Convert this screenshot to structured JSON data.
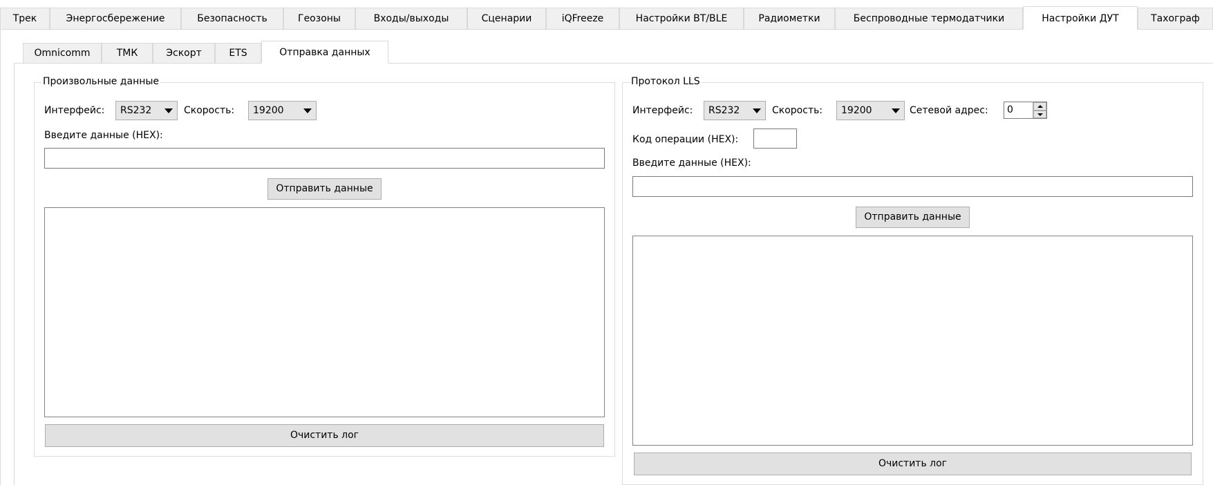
{
  "top_tabs": [
    "Трек",
    "Энергосбережение",
    "Безопасность",
    "Геозоны",
    "Входы/выходы",
    "Сценарии",
    "iQFreeze",
    "Настройки BT/BLE",
    "Радиометки",
    "Беспроводные термодатчики",
    "Настройки ДУТ",
    "Тахограф"
  ],
  "top_tabs_active": "Настройки ДУТ",
  "sub_tabs": [
    "Omnicomm",
    "ТМК",
    "Эскорт",
    "ETS",
    "Отправка данных"
  ],
  "sub_tabs_active": "Отправка данных",
  "left": {
    "title": "Произвольные данные",
    "interface_label": "Интерфейс:",
    "interface_value": "RS232",
    "speed_label": "Скорость:",
    "speed_value": "19200",
    "data_label": "Введите данные (HEX):",
    "data_value": "",
    "send_button": "Отправить данные",
    "log_text": "",
    "clear_button": "Очистить лог"
  },
  "right": {
    "title": "Протокол LLS",
    "interface_label": "Интерфейс:",
    "interface_value": "RS232",
    "speed_label": "Скорость:",
    "speed_value": "19200",
    "address_label": "Сетевой адрес:",
    "address_value": "0",
    "opcode_label": "Код операции (HEX):",
    "opcode_value": "",
    "data_label": "Введите данные (HEX):",
    "data_value": "",
    "send_button": "Отправить данные",
    "log_text": "",
    "clear_button": "Очистить лог"
  }
}
